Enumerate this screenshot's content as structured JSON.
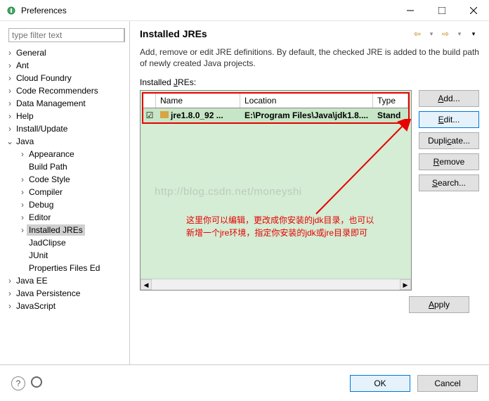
{
  "window": {
    "title": "Preferences"
  },
  "filter": {
    "placeholder": "type filter text"
  },
  "tree": [
    {
      "label": "General",
      "arrow": ">",
      "lvl": 0
    },
    {
      "label": "Ant",
      "arrow": ">",
      "lvl": 0
    },
    {
      "label": "Cloud Foundry",
      "arrow": ">",
      "lvl": 0
    },
    {
      "label": "Code Recommenders",
      "arrow": ">",
      "lvl": 0
    },
    {
      "label": "Data Management",
      "arrow": ">",
      "lvl": 0
    },
    {
      "label": "Help",
      "arrow": ">",
      "lvl": 0
    },
    {
      "label": "Install/Update",
      "arrow": ">",
      "lvl": 0
    },
    {
      "label": "Java",
      "arrow": "v",
      "lvl": 0
    },
    {
      "label": "Appearance",
      "arrow": ">",
      "lvl": 1
    },
    {
      "label": "Build Path",
      "arrow": "",
      "lvl": 1
    },
    {
      "label": "Code Style",
      "arrow": ">",
      "lvl": 1
    },
    {
      "label": "Compiler",
      "arrow": ">",
      "lvl": 1
    },
    {
      "label": "Debug",
      "arrow": ">",
      "lvl": 1
    },
    {
      "label": "Editor",
      "arrow": ">",
      "lvl": 1
    },
    {
      "label": "Installed JREs",
      "arrow": ">",
      "lvl": 1,
      "selected": true
    },
    {
      "label": "JadClipse",
      "arrow": "",
      "lvl": 1
    },
    {
      "label": "JUnit",
      "arrow": "",
      "lvl": 1
    },
    {
      "label": "Properties Files Ed",
      "arrow": "",
      "lvl": 1
    },
    {
      "label": "Java EE",
      "arrow": ">",
      "lvl": 0
    },
    {
      "label": "Java Persistence",
      "arrow": ">",
      "lvl": 0
    },
    {
      "label": "JavaScript",
      "arrow": ">",
      "lvl": 0
    }
  ],
  "main": {
    "title": "Installed JREs",
    "desc": "Add, remove or edit JRE definitions. By default, the checked JRE is added to the build path of newly created Java projects.",
    "table_label": "Installed JREs:",
    "cols": {
      "name": "Name",
      "location": "Location",
      "type": "Type"
    },
    "row": {
      "name": "jre1.8.0_92 ...",
      "location": "E:\\Program Files\\Java\\jdk1.8....",
      "type": "Stand"
    },
    "buttons": {
      "add": "Add...",
      "edit": "Edit...",
      "duplicate": "Duplicate...",
      "remove": "Remove",
      "search": "Search..."
    },
    "apply": "Apply"
  },
  "annotation": {
    "line1": "这里你可以编辑，更改成你安装的jdk目录，也可以",
    "line2": "新增一个jre环境，指定你安装的jdk或jre目录即可"
  },
  "watermark": "http://blog.csdn.net/moneyshi",
  "bottom": {
    "ok": "OK",
    "cancel": "Cancel"
  }
}
